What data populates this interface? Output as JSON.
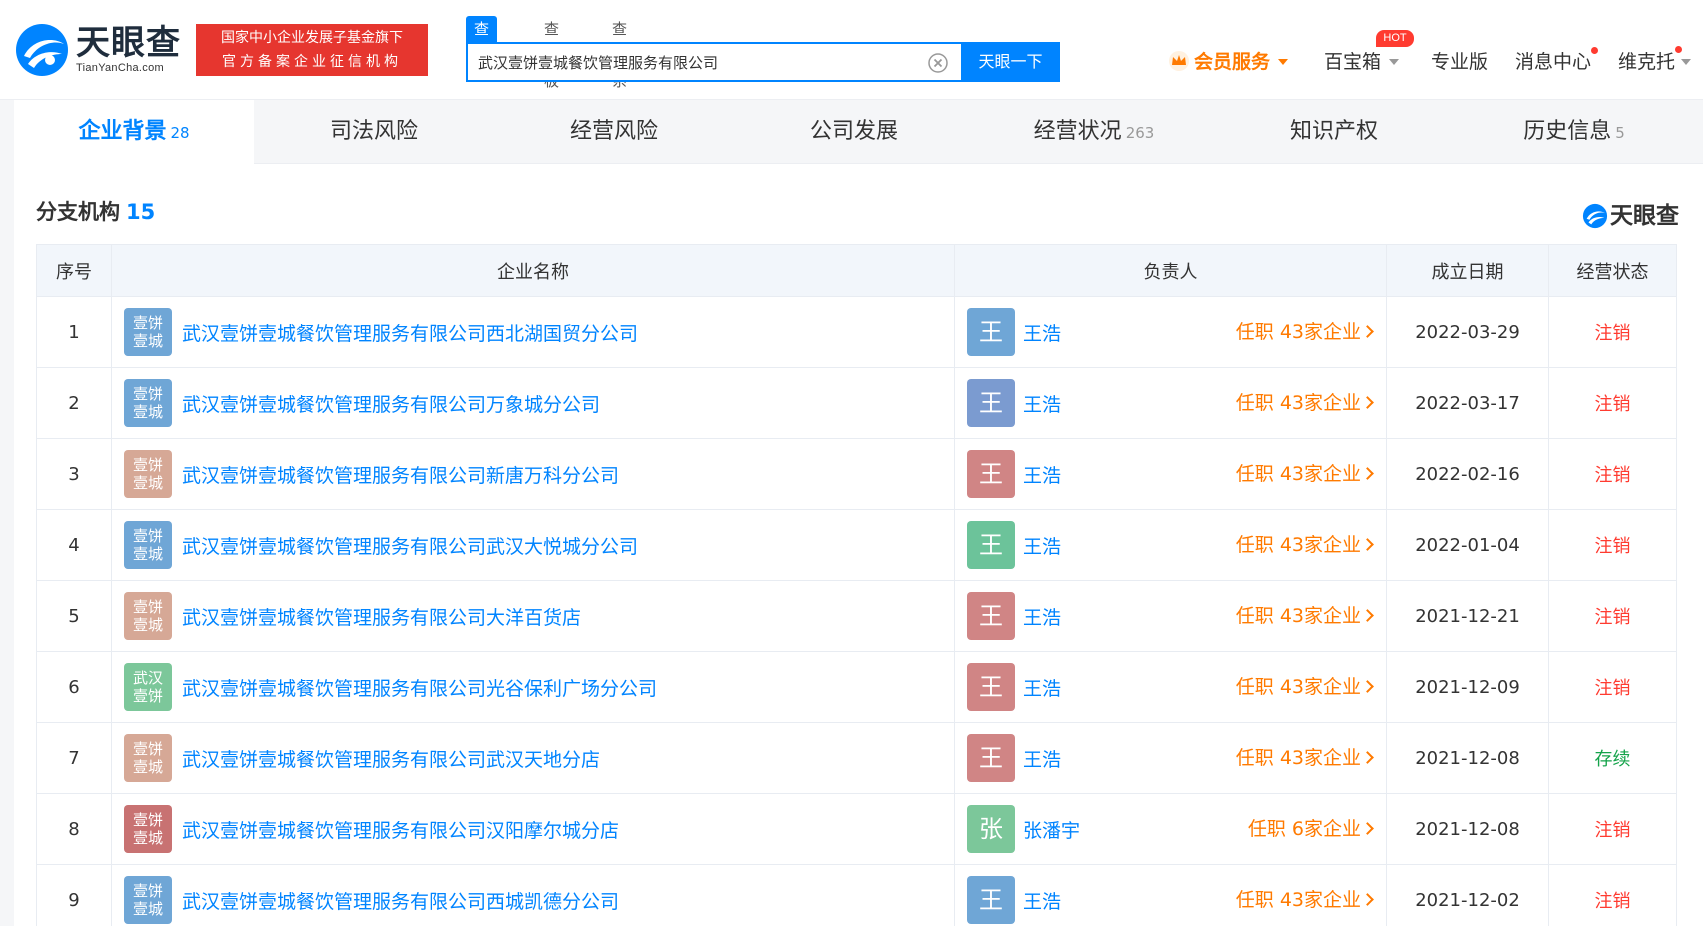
{
  "header": {
    "logo_text": "天眼查",
    "logo_sub": "TianYanCha.com",
    "red_line1": "国家中小企业发展子基金旗下",
    "red_line2": "官方备案企业征信机构",
    "search_tabs": [
      "查公司",
      "查老板",
      "查关系"
    ],
    "search_value": "武汉壹饼壹城餐饮管理服务有限公司",
    "search_button": "天眼一下",
    "vip": "会员服务",
    "baobao": "百宝箱",
    "hot": "HOT",
    "pro": "专业版",
    "messages": "消息中心",
    "user": "维克托"
  },
  "tabs": [
    {
      "label": "企业背景",
      "count": "28"
    },
    {
      "label": "司法风险",
      "count": ""
    },
    {
      "label": "经营风险",
      "count": ""
    },
    {
      "label": "公司发展",
      "count": ""
    },
    {
      "label": "经营状况",
      "count": "263"
    },
    {
      "label": "知识产权",
      "count": ""
    },
    {
      "label": "历史信息",
      "count": "5"
    }
  ],
  "section": {
    "title": "分支机构",
    "count": "15",
    "watermark": "天眼查"
  },
  "table": {
    "headers": [
      "序号",
      "企业名称",
      "负责人",
      "成立日期",
      "经营状态"
    ],
    "rows": [
      {
        "no": "1",
        "logo": [
          "壹饼",
          "壹城"
        ],
        "logo_color": "#6fa6d6",
        "name": "武汉壹饼壹城餐饮管理服务有限公司西北湖国贸分公司",
        "avatar": "王",
        "avatar_color": "#6fa6d6",
        "person": "王浩",
        "jobs": "任职 43家企业",
        "date": "2022-03-29",
        "status": "注销"
      },
      {
        "no": "2",
        "logo": [
          "壹饼",
          "壹城"
        ],
        "logo_color": "#6fa6d6",
        "name": "武汉壹饼壹城餐饮管理服务有限公司万象城分公司",
        "avatar": "王",
        "avatar_color": "#7b9bd0",
        "person": "王浩",
        "jobs": "任职 43家企业",
        "date": "2022-03-17",
        "status": "注销"
      },
      {
        "no": "3",
        "logo": [
          "壹饼",
          "壹城"
        ],
        "logo_color": "#d6a896",
        "name": "武汉壹饼壹城餐饮管理服务有限公司新唐万科分公司",
        "avatar": "王",
        "avatar_color": "#d08585",
        "person": "王浩",
        "jobs": "任职 43家企业",
        "date": "2022-02-16",
        "status": "注销"
      },
      {
        "no": "4",
        "logo": [
          "壹饼",
          "壹城"
        ],
        "logo_color": "#6fa6d6",
        "name": "武汉壹饼壹城餐饮管理服务有限公司武汉大悦城分公司",
        "avatar": "王",
        "avatar_color": "#6cc39a",
        "person": "王浩",
        "jobs": "任职 43家企业",
        "date": "2022-01-04",
        "status": "注销"
      },
      {
        "no": "5",
        "logo": [
          "壹饼",
          "壹城"
        ],
        "logo_color": "#d6a896",
        "name": "武汉壹饼壹城餐饮管理服务有限公司大洋百货店",
        "avatar": "王",
        "avatar_color": "#d08585",
        "person": "王浩",
        "jobs": "任职 43家企业",
        "date": "2021-12-21",
        "status": "注销"
      },
      {
        "no": "6",
        "logo": [
          "武汉",
          "壹饼"
        ],
        "logo_color": "#7cc79a",
        "name": "武汉壹饼壹城餐饮管理服务有限公司光谷保利广场分公司",
        "avatar": "王",
        "avatar_color": "#d08585",
        "person": "王浩",
        "jobs": "任职 43家企业",
        "date": "2021-12-09",
        "status": "注销"
      },
      {
        "no": "7",
        "logo": [
          "壹饼",
          "壹城"
        ],
        "logo_color": "#d6a896",
        "name": "武汉壹饼壹城餐饮管理服务有限公司武汉天地分店",
        "avatar": "王",
        "avatar_color": "#d08585",
        "person": "王浩",
        "jobs": "任职 43家企业",
        "date": "2021-12-08",
        "status": "存续"
      },
      {
        "no": "8",
        "logo": [
          "壹饼",
          "壹城"
        ],
        "logo_color": "#c87272",
        "name": "武汉壹饼壹城餐饮管理服务有限公司汉阳摩尔城分店",
        "avatar": "张",
        "avatar_color": "#7cc79a",
        "person": "张潘宇",
        "jobs": "任职 6家企业",
        "date": "2021-12-08",
        "status": "注销"
      },
      {
        "no": "9",
        "logo": [
          "壹饼",
          "壹城"
        ],
        "logo_color": "#6fa6d6",
        "name": "武汉壹饼壹城餐饮管理服务有限公司西城凯德分公司",
        "avatar": "王",
        "avatar_color": "#6fa6d6",
        "person": "王浩",
        "jobs": "任职 43家企业",
        "date": "2021-12-02",
        "status": "注销"
      }
    ]
  },
  "colors": {
    "accent": "#0084ff",
    "orange": "#ff7a00",
    "red": "#ff3b30",
    "green": "#14a34a",
    "brand_red": "#e6362f"
  }
}
